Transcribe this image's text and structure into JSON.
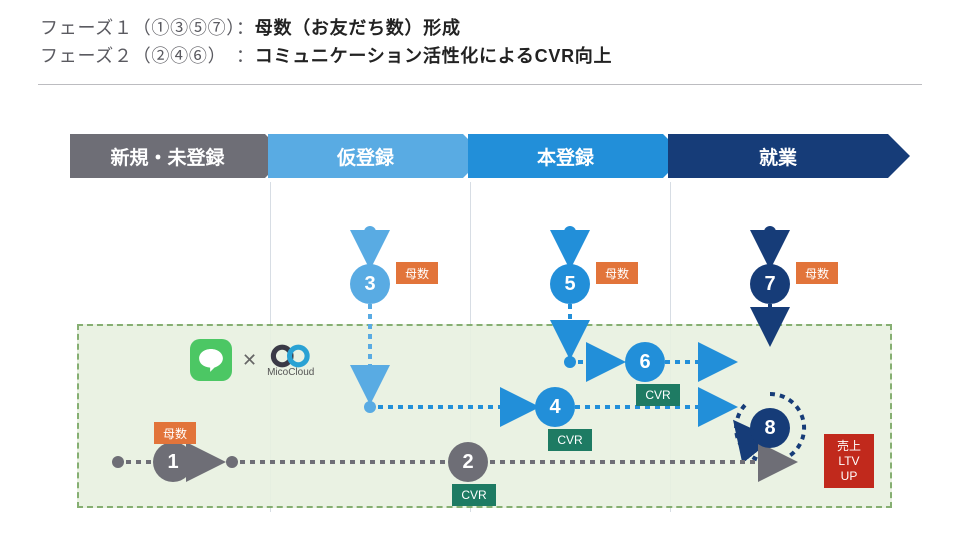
{
  "header": {
    "row1_label": "フェーズ１（①③⑤⑦）：",
    "row1_bold": "母数（お友だち数）形成",
    "row2_label": "フェーズ２（②④⑥）　：",
    "row2_bold": "コミュニケーション活性化によるCVR向上"
  },
  "arrows": {
    "a1": "新規・未登録",
    "a2": "仮登録",
    "a3": "本登録",
    "a4": "就業"
  },
  "nodes": {
    "n1": "1",
    "n2": "2",
    "n3": "3",
    "n4": "4",
    "n5": "5",
    "n6": "6",
    "n7": "7",
    "n8": "8"
  },
  "tags": {
    "mom": "母数",
    "cvr": "CVR",
    "red": "売上\nLTV\nUP"
  },
  "logos": {
    "line_name": "LINE",
    "x_glyph": "✕",
    "mico": "MicoCloud"
  },
  "colors": {
    "grey": "#6e6e76",
    "lblue": "#59abe3",
    "mblue": "#228fd9",
    "dblue": "#163c78",
    "orange": "#e2743a",
    "teal": "#1e7b63",
    "red": "#c1291c"
  }
}
